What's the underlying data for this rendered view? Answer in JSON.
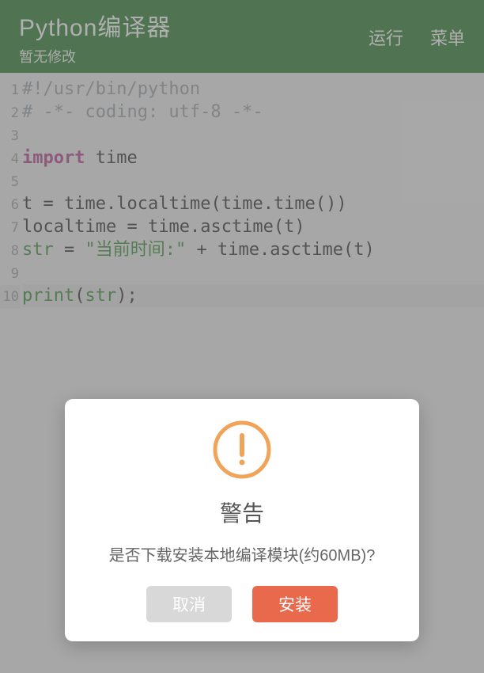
{
  "header": {
    "title": "Python编译器",
    "subtitle": "暂无修改",
    "run_label": "运行",
    "menu_label": "菜单"
  },
  "code": {
    "lines": [
      {
        "n": "1",
        "tokens": [
          {
            "cls": "c-comment",
            "t": "#!/usr/bin/python"
          }
        ]
      },
      {
        "n": "2",
        "tokens": [
          {
            "cls": "c-comment",
            "t": "# -*- coding: utf-8 -*-"
          }
        ]
      },
      {
        "n": "3",
        "tokens": []
      },
      {
        "n": "4",
        "tokens": [
          {
            "cls": "c-kw",
            "t": "import"
          },
          {
            "cls": "",
            "t": " "
          },
          {
            "cls": "c-id",
            "t": "time"
          }
        ]
      },
      {
        "n": "5",
        "tokens": []
      },
      {
        "n": "6",
        "tokens": [
          {
            "cls": "c-id",
            "t": "t"
          },
          {
            "cls": "",
            "t": " = "
          },
          {
            "cls": "c-id",
            "t": "time"
          },
          {
            "cls": "c-punc",
            "t": "."
          },
          {
            "cls": "c-id",
            "t": "localtime"
          },
          {
            "cls": "c-punc",
            "t": "("
          },
          {
            "cls": "c-id",
            "t": "time"
          },
          {
            "cls": "c-punc",
            "t": "."
          },
          {
            "cls": "c-id",
            "t": "time"
          },
          {
            "cls": "c-punc",
            "t": "())"
          }
        ]
      },
      {
        "n": "7",
        "tokens": [
          {
            "cls": "c-id",
            "t": "localtime"
          },
          {
            "cls": "",
            "t": " = "
          },
          {
            "cls": "c-id",
            "t": "time"
          },
          {
            "cls": "c-punc",
            "t": "."
          },
          {
            "cls": "c-id",
            "t": "asctime"
          },
          {
            "cls": "c-punc",
            "t": "("
          },
          {
            "cls": "c-id",
            "t": "t"
          },
          {
            "cls": "c-punc",
            "t": ")"
          }
        ]
      },
      {
        "n": "8",
        "tokens": [
          {
            "cls": "c-builtin",
            "t": "str"
          },
          {
            "cls": "",
            "t": " = "
          },
          {
            "cls": "c-str",
            "t": "\"当前时间:\""
          },
          {
            "cls": "",
            "t": " + "
          },
          {
            "cls": "c-id",
            "t": "time"
          },
          {
            "cls": "c-punc",
            "t": "."
          },
          {
            "cls": "c-id",
            "t": "asctime"
          },
          {
            "cls": "c-punc",
            "t": "("
          },
          {
            "cls": "c-id",
            "t": "t"
          },
          {
            "cls": "c-punc",
            "t": ")"
          }
        ]
      },
      {
        "n": "9",
        "tokens": []
      },
      {
        "n": "10",
        "tokens": [
          {
            "cls": "c-builtin",
            "t": "print"
          },
          {
            "cls": "c-punc",
            "t": "("
          },
          {
            "cls": "c-builtin",
            "t": "str"
          },
          {
            "cls": "c-punc",
            "t": ");"
          }
        ],
        "current": true
      }
    ]
  },
  "dialog": {
    "title": "警告",
    "message": "是否下载安装本地编译模块(约60MB)?",
    "cancel_label": "取消",
    "install_label": "安装",
    "icon_color": "#f0a45a"
  }
}
